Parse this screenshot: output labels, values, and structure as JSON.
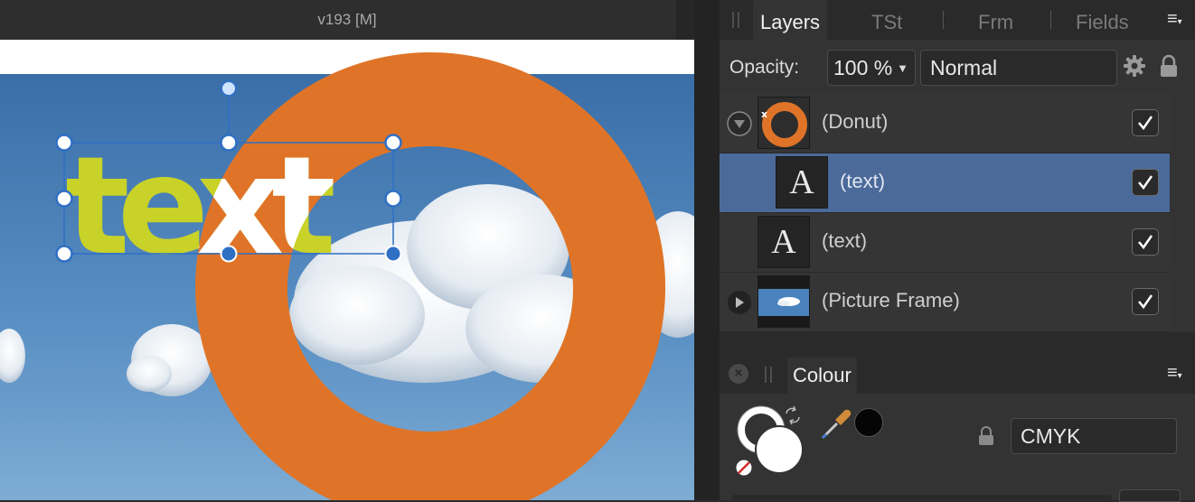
{
  "window": {
    "title": "v193  [M]"
  },
  "canvas": {
    "text_object": "text",
    "colors": {
      "text_fill": "#c8d228",
      "text_knockout": "#ffffff",
      "donut": "#df7428",
      "handle": "#2f6fc4",
      "sky": "#4a7fb8"
    }
  },
  "panel": {
    "tabs": [
      {
        "label": "Layers",
        "active": true
      },
      {
        "label": "TSt",
        "active": false
      },
      {
        "label": "Frm",
        "active": false
      },
      {
        "label": "Fields",
        "active": false
      }
    ],
    "menu_icon": "hamburger-menu-icon",
    "opacity_label": "Opacity:",
    "opacity_value": "100 %",
    "blend_mode": "Normal",
    "layers": [
      {
        "name": "(Donut)",
        "expanded": true,
        "visible": true,
        "selected": false,
        "thumb": "donut"
      },
      {
        "name": "(text)",
        "visible": true,
        "selected": true,
        "thumb": "A"
      },
      {
        "name": "(text)",
        "visible": true,
        "selected": false,
        "thumb": "A"
      },
      {
        "name": "(Picture Frame)",
        "expanded": false,
        "visible": true,
        "selected": false,
        "thumb": "sky"
      }
    ]
  },
  "colour": {
    "tab_label": "Colour",
    "model": "CMYK"
  },
  "accent": {
    "selection": "#4b6a9a"
  }
}
